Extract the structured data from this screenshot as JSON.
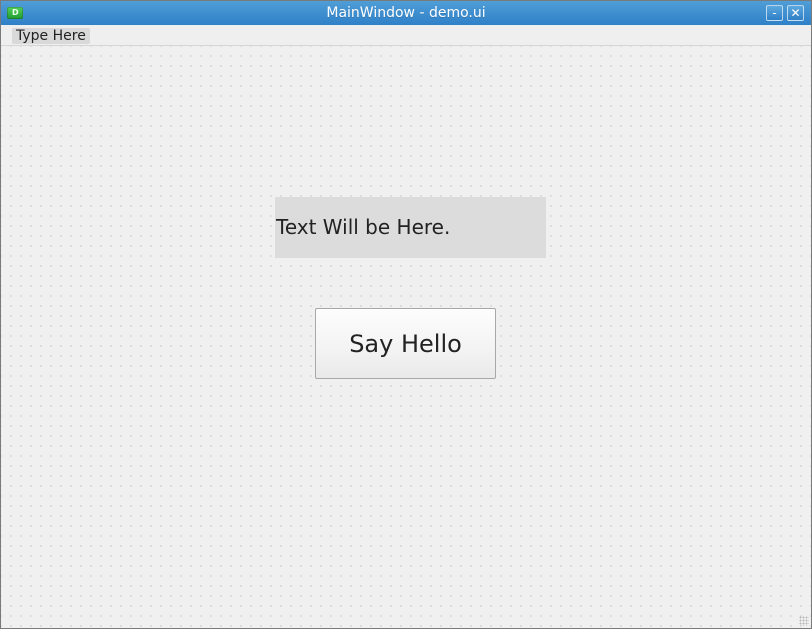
{
  "window": {
    "title": "MainWindow - demo.ui",
    "buttons": {
      "minimize": "-",
      "close": "✕"
    }
  },
  "menubar": {
    "items": [
      {
        "label": "Type Here"
      }
    ]
  },
  "form": {
    "label_text": "Text Will be Here.",
    "button_label": "Say Hello"
  },
  "colors": {
    "titlebar_top": "#4f9ed7",
    "titlebar_bottom": "#2f80c8",
    "window_background": "#f0f0f0",
    "label_background": "#dcdcdc",
    "menu_highlight": "#d9d9d9"
  },
  "icons": {
    "app": "app-icon",
    "minimize": "minimize-icon",
    "close": "close-icon",
    "resize": "resize-grip-icon"
  }
}
